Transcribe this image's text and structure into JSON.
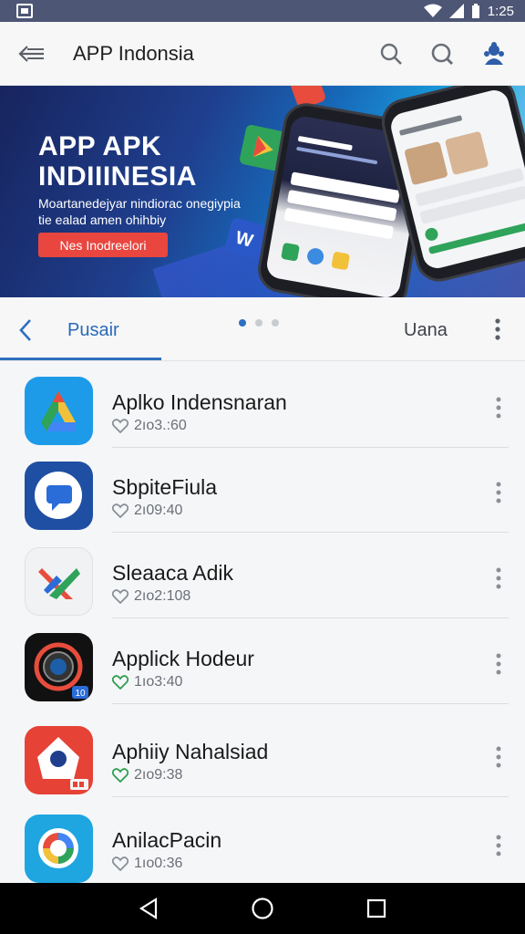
{
  "status_bar": {
    "time": "1:25"
  },
  "app_bar": {
    "title": "APP Indonsia"
  },
  "banner": {
    "title_line1": "APP APK",
    "title_line2": "INDIIINESIA",
    "subtitle_line1": "Moartanedejyar nindiorac onegiypia",
    "subtitle_line2": "tie ealad amen ohihbiy",
    "cta_label": "Nes Inodreelori"
  },
  "tabs": {
    "active_label": "Pusair",
    "secondary_label": "Uana",
    "page_dots": 3,
    "active_dot": 0
  },
  "apps": [
    {
      "name": "Aplko Indensnaran",
      "stat": "2ıo3.:60",
      "heart_color": "#8a8f96",
      "icon": "drive-icon"
    },
    {
      "name": "SbpiteFiula",
      "stat": "2ı09:40",
      "heart_color": "#8a8f96",
      "icon": "chat-bubble-icon"
    },
    {
      "name": "Sleaaca Adik",
      "stat": "2ıo2:108",
      "heart_color": "#8a8f96",
      "icon": "cross-arrows-icon"
    },
    {
      "name": "Applick Hodeur",
      "stat": "1ıo3:40",
      "heart_color": "#2e9e4f",
      "icon": "camera-lens-icon",
      "badge": "10"
    },
    {
      "name": "Aphiiy Nahalsiad",
      "stat": "2ıo9:38",
      "heart_color": "#2e9e4f",
      "icon": "home-pin-icon"
    },
    {
      "name": "AnilacPacin",
      "stat": "1ıo0:36",
      "heart_color": "#8a8f96",
      "icon": "google-color-icon"
    }
  ],
  "colors": {
    "accent": "#2f6fc0",
    "status_bar": "#4d5675",
    "cta": "#e8463f"
  }
}
